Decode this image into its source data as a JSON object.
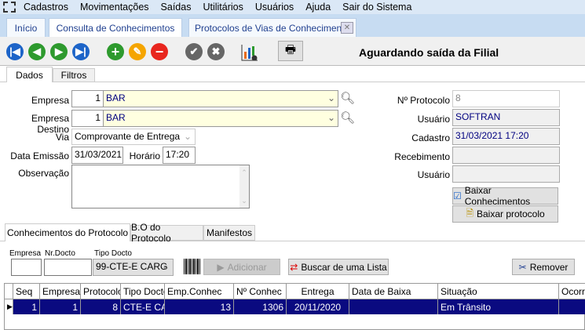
{
  "menu": [
    "Cadastros",
    "Movimentações",
    "Saídas",
    "Utilitários",
    "Usuários",
    "Ajuda",
    "Sair do Sistema"
  ],
  "doc_tabs": [
    "Início",
    "Consulta de Conhecimentos",
    "Protocolos de Vias de Conhecimento"
  ],
  "toolbar": {
    "title": "Aguardando saída da Filial",
    "icons": [
      "first-icon",
      "previous-icon",
      "next-icon",
      "last-icon",
      "add-icon",
      "edit-icon",
      "delete-icon",
      "confirm-icon",
      "cancel-icon",
      "chart-settings-icon",
      "print-icon"
    ]
  },
  "form_tabs": [
    "Dados",
    "Filtros"
  ],
  "form": {
    "empresa_label": "Empresa",
    "empresa_code": "1",
    "empresa_name": "BAR",
    "destino_label": "Empresa Destino",
    "destino_code": "1",
    "destino_name": "BAR",
    "via_label": "Via",
    "via_value": "Comprovante de Entrega",
    "data_label": "Data Emissão",
    "data_value": "31/03/2021",
    "horario_label": "Horário",
    "horario_value": "17:20",
    "obs_label": "Observação",
    "obs_value": ""
  },
  "right": {
    "protocolo_label": "Nº Protocolo",
    "protocolo_value": "8",
    "usuario_label": "Usuário",
    "usuario_value": "SOFTRAN",
    "cadastro_label": "Cadastro",
    "cadastro_value": "31/03/2021 17:20",
    "recebimento_label": "Recebimento",
    "recebimento_value": "",
    "usuario2_label": "Usuário",
    "usuario2_value": "",
    "baixar_conhec": "Baixar Conhecimentos",
    "baixar_protocolo": "Baixar protocolo"
  },
  "lower_tabs": [
    "Conhecimentos do Protocolo",
    "B.O do Protocolo",
    "Manifestos"
  ],
  "lower": {
    "empresa_label": "Empresa",
    "nrdocto_label": "Nr.Docto",
    "tipo_label": "Tipo Docto",
    "tipo_value": "99-CTE-E CARG",
    "adicionar": "Adicionar",
    "buscar": "Buscar de uma Lista",
    "remover": "Remover"
  },
  "grid": {
    "columns": [
      "Seq",
      "Empresa",
      "Protocolo",
      "Tipo Docto",
      "Emp.Conhec",
      "Nº Conhec",
      "Entrega",
      "Data de Baixa",
      "Situação",
      "Ocorrê"
    ],
    "rows": [
      [
        "1",
        "1",
        "8",
        "CTE-E CAR",
        "13",
        "1306",
        "20/11/2020",
        "",
        "Em Trânsito",
        ""
      ]
    ]
  }
}
